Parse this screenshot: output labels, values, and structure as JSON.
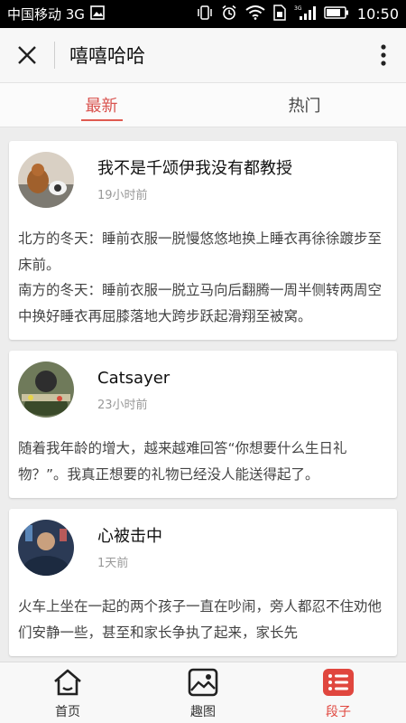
{
  "status_bar": {
    "carrier": "中国移动 3G",
    "time": "10:50",
    "signal_label": "3G"
  },
  "header": {
    "title": "嘻嘻哈哈"
  },
  "tabs": [
    {
      "label": "最新",
      "active": true
    },
    {
      "label": "热门",
      "active": false
    }
  ],
  "posts": [
    {
      "username": "我不是千颂伊我没有都教授",
      "time": "19小时前",
      "content": "北方的冬天：睡前衣服一脱慢悠悠地换上睡衣再徐徐踱步至床前。\n南方的冬天：睡前衣服一脱立马向后翻腾一周半侧转两周空中换好睡衣再屈膝落地大跨步跃起滑翔至被窝。"
    },
    {
      "username": "Catsayer",
      "time": "23小时前",
      "content": "随着我年龄的增大，越来越难回答“你想要什么生日礼物？”。我真正想要的礼物已经没人能送得起了。"
    },
    {
      "username": "心被击中",
      "time": "1天前",
      "content": "火车上坐在一起的两个孩子一直在吵闹，旁人都忍不住劝他们安静一些，甚至和家长争执了起来，家长先"
    }
  ],
  "bottom_nav": [
    {
      "label": "首页",
      "icon": "home-icon",
      "active": false
    },
    {
      "label": "趣图",
      "icon": "image-icon",
      "active": false
    },
    {
      "label": "段子",
      "icon": "list-icon",
      "active": true
    }
  ],
  "colors": {
    "accent": "#e0463e",
    "status_bar": "#000000"
  }
}
